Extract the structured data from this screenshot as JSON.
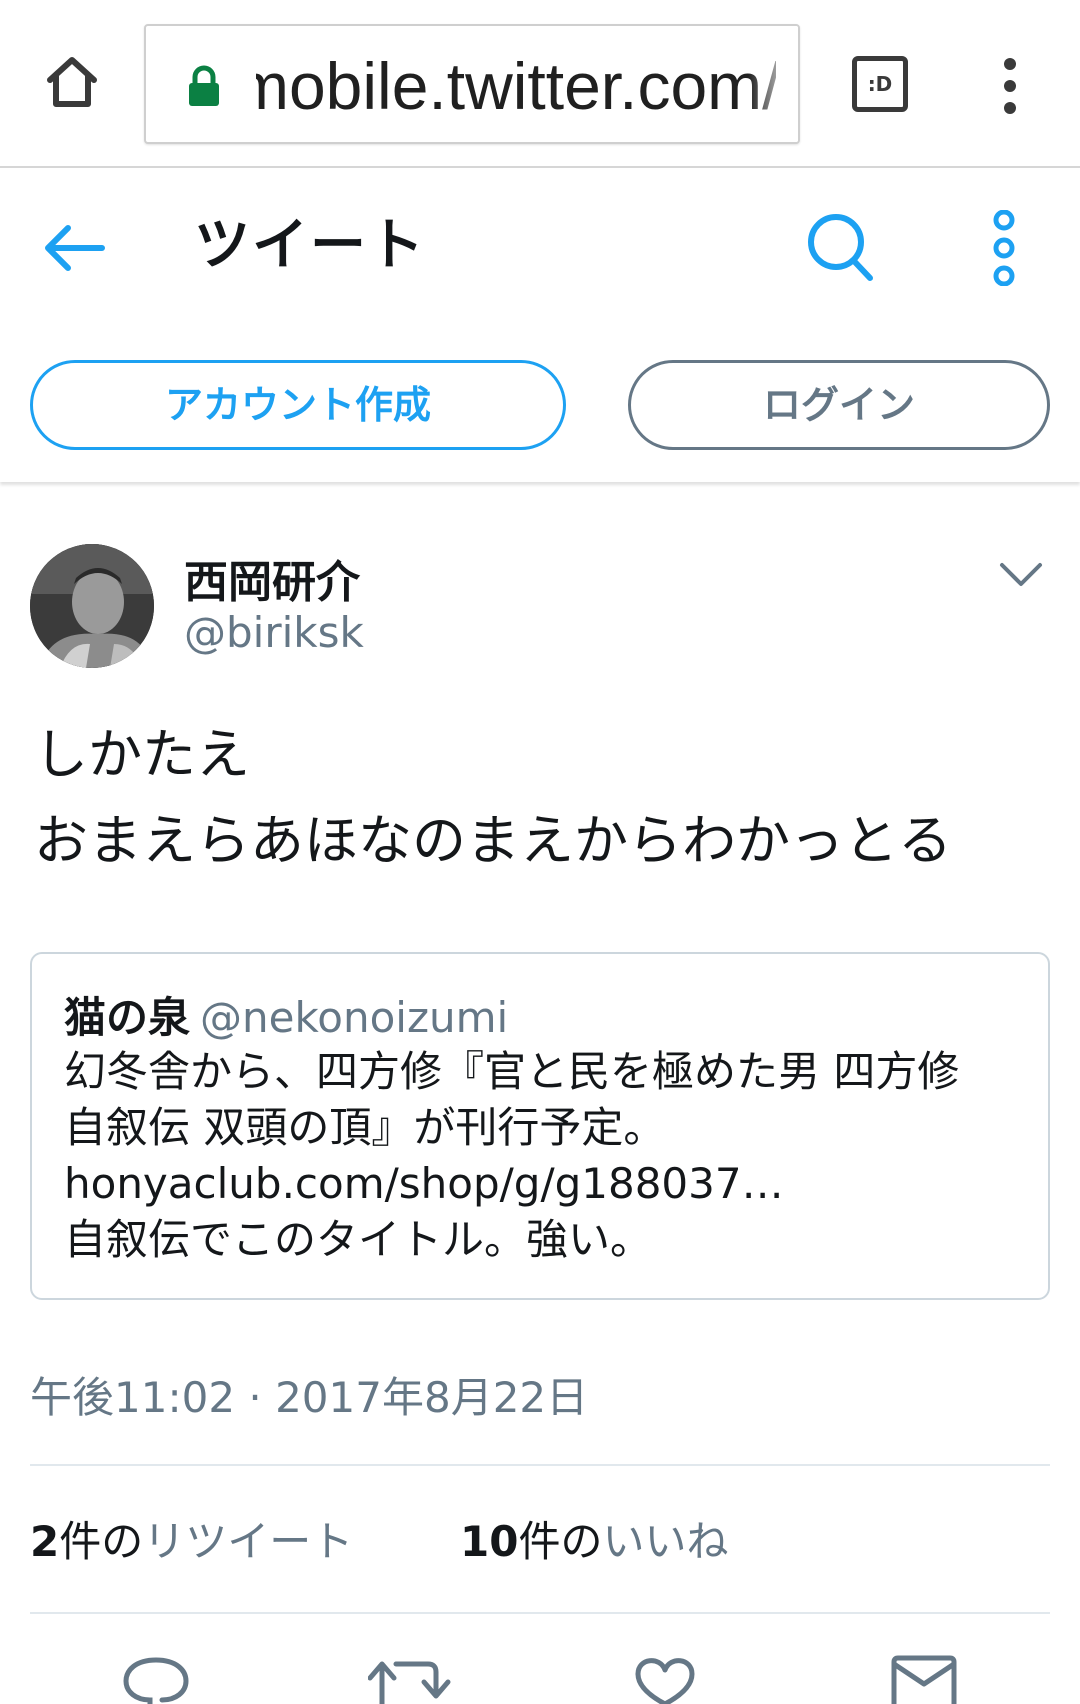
{
  "browser": {
    "url": "mobile.twitter.com/b",
    "tabs_label": ":D",
    "icons": {
      "home": "home-icon",
      "lock": "lock-icon",
      "menu": "vertical-dots-icon"
    },
    "lock_color": "#0b8043"
  },
  "header": {
    "title": "ツイート",
    "signup_label": "アカウント作成",
    "login_label": "ログイン",
    "accent_color": "#1da1f2"
  },
  "tweet": {
    "author_name": "西岡研介",
    "author_handle": "@biriksk",
    "text_lines": [
      "しかたえ",
      "おまえらあほなのまえからわかっとる"
    ],
    "quote": {
      "author_name": "猫の泉",
      "author_handle": "@nekonoizumi",
      "lines": [
        "幻冬舎から、四方修『官と民を極めた男 四方修",
        "自叙伝 双頭の頂』が刊行予定。",
        "honyaclub.com/shop/g/g188037…",
        "自叙伝でこのタイトル。強い。"
      ]
    },
    "timestamp": "午後11:02 · 2017年8月22日",
    "retweets": {
      "count": "2",
      "unit": "件の",
      "label": "リツイート"
    },
    "likes": {
      "count": "10",
      "unit": "件の",
      "label": "いいね"
    }
  },
  "actions": [
    {
      "icon": "reply-icon"
    },
    {
      "icon": "retweet-icon"
    },
    {
      "icon": "like-icon"
    },
    {
      "icon": "message-icon"
    }
  ]
}
